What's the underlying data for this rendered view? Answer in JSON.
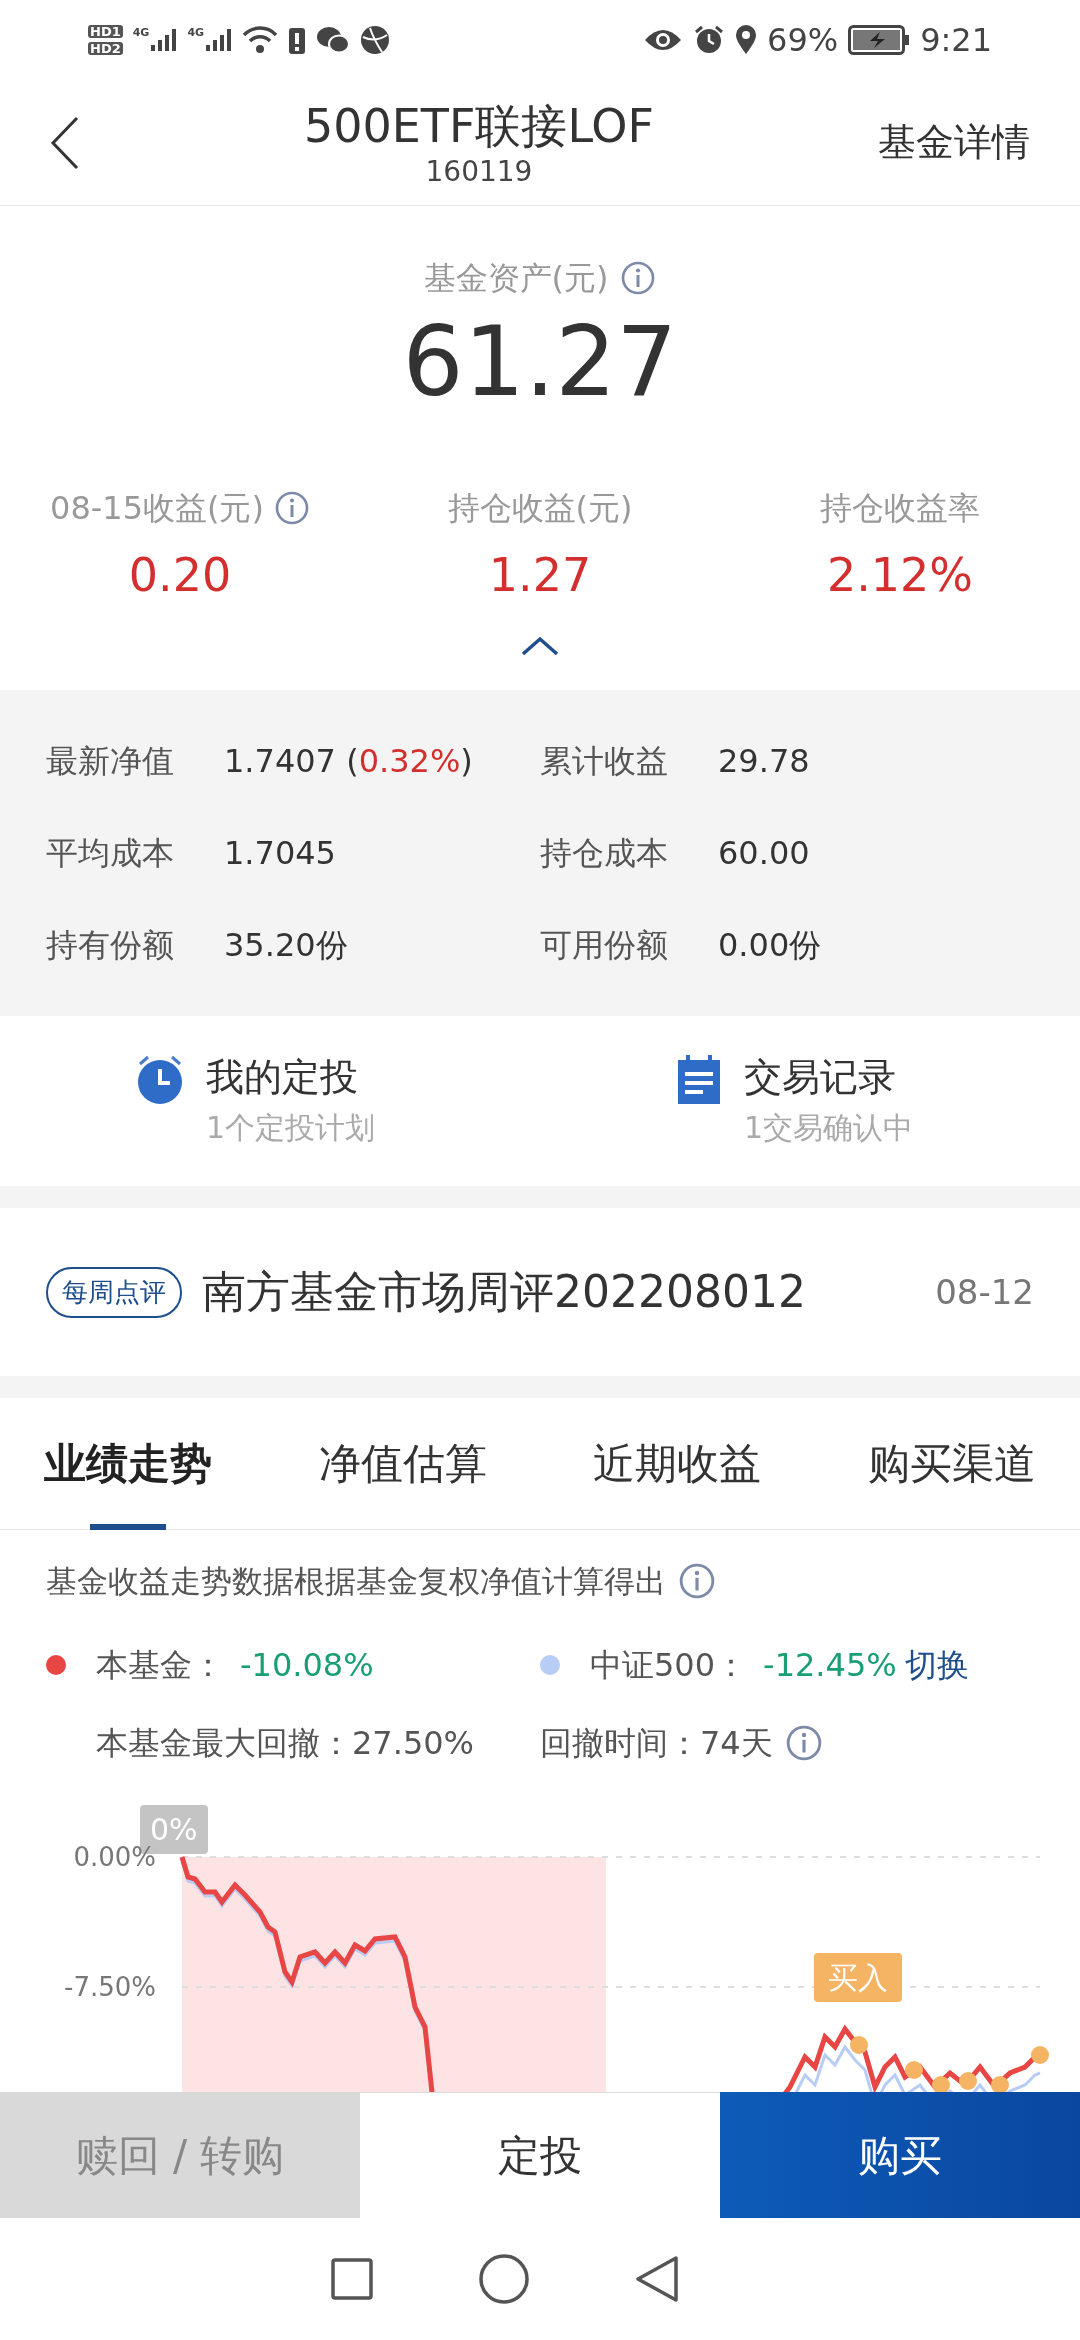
{
  "status_bar": {
    "sim_labels": [
      "HD1",
      "HD2"
    ],
    "network_labels": [
      "4G",
      "4G"
    ],
    "battery": "69%",
    "time": "9:21"
  },
  "header": {
    "title": "500ETF联接LOF",
    "code": "160119",
    "action": "基金详情"
  },
  "asset": {
    "label": "基金资产(元)",
    "value": "61.27"
  },
  "stats": [
    {
      "label": "08-15收益(元)",
      "value": "0.20",
      "info": true
    },
    {
      "label": "持仓收益(元)",
      "value": "1.27",
      "info": false
    },
    {
      "label": "持仓收益率",
      "value": "2.12%",
      "info": false
    }
  ],
  "details_expanded": true,
  "details": [
    {
      "label": "最新净值",
      "value": "1.7407",
      "change": "0.32%",
      "change_wrap": [
        "(",
        ")"
      ]
    },
    {
      "label": "累计收益",
      "value": "29.78"
    },
    {
      "label": "平均成本",
      "value": "1.7045"
    },
    {
      "label": "持仓成本",
      "value": "60.00"
    },
    {
      "label": "持有份额",
      "value": "35.20份"
    },
    {
      "label": "可用份额",
      "value": "0.00份"
    }
  ],
  "shortcuts": [
    {
      "title": "我的定投",
      "subtitle": "1个定投计划"
    },
    {
      "title": "交易记录",
      "subtitle": "1交易确认中"
    }
  ],
  "news": {
    "tag": "每周点评",
    "title": "南方基金市场周评202208012",
    "date": "08-12"
  },
  "tabs": [
    {
      "label": "业绩走势",
      "selected": true
    },
    {
      "label": "净值估算",
      "selected": false
    },
    {
      "label": "近期收益",
      "selected": false
    },
    {
      "label": "购买渠道",
      "selected": false
    }
  ],
  "chart_note": "基金收益走势数据根据基金复权净值计算得出",
  "legend": [
    {
      "name": "本基金：",
      "value": "-10.08%",
      "color": "#e84545"
    },
    {
      "name": "中证500：",
      "value": "-12.45%",
      "color": "#b7cdf5",
      "action": "切换"
    }
  ],
  "drawdown": [
    {
      "label": "本基金最大回撤：",
      "value": "27.50%",
      "info": false
    },
    {
      "label": "回撤时间：",
      "value": "74天",
      "info": true
    }
  ],
  "chart": {
    "start_badge": "0%",
    "y_labels": [
      "0.00%",
      "-7.50%"
    ],
    "buy_badge": "买入"
  },
  "bottom_buttons": [
    {
      "label": "赎回 / 转购",
      "kind": "disabled"
    },
    {
      "label": "定投",
      "kind": "plain"
    },
    {
      "label": "购买",
      "kind": "primary"
    }
  ]
}
